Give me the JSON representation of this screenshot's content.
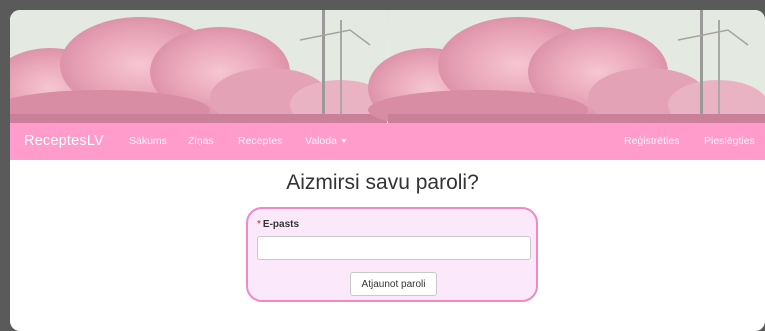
{
  "navbar": {
    "brand": "ReceptesLV",
    "items": [
      {
        "label": "Sākums"
      },
      {
        "label": "Ziņas"
      },
      {
        "label": "Receptes"
      },
      {
        "label": "Valoda"
      }
    ],
    "right_items": [
      {
        "label": "Reģistrēties"
      },
      {
        "label": "Pieslēgties"
      }
    ]
  },
  "main": {
    "title": "Aizmirsi savu paroli?",
    "form": {
      "required_marker": "*",
      "email_label": "E-pasts",
      "email_value": "",
      "email_placeholder": "",
      "submit_label": "Atjaunot paroli"
    }
  },
  "colors": {
    "navbar_bg": "#ff9ccb",
    "form_bg": "#fce8fb",
    "form_border": "#f08ac3"
  },
  "icons": {
    "language_caret": "caret-down-icon"
  }
}
